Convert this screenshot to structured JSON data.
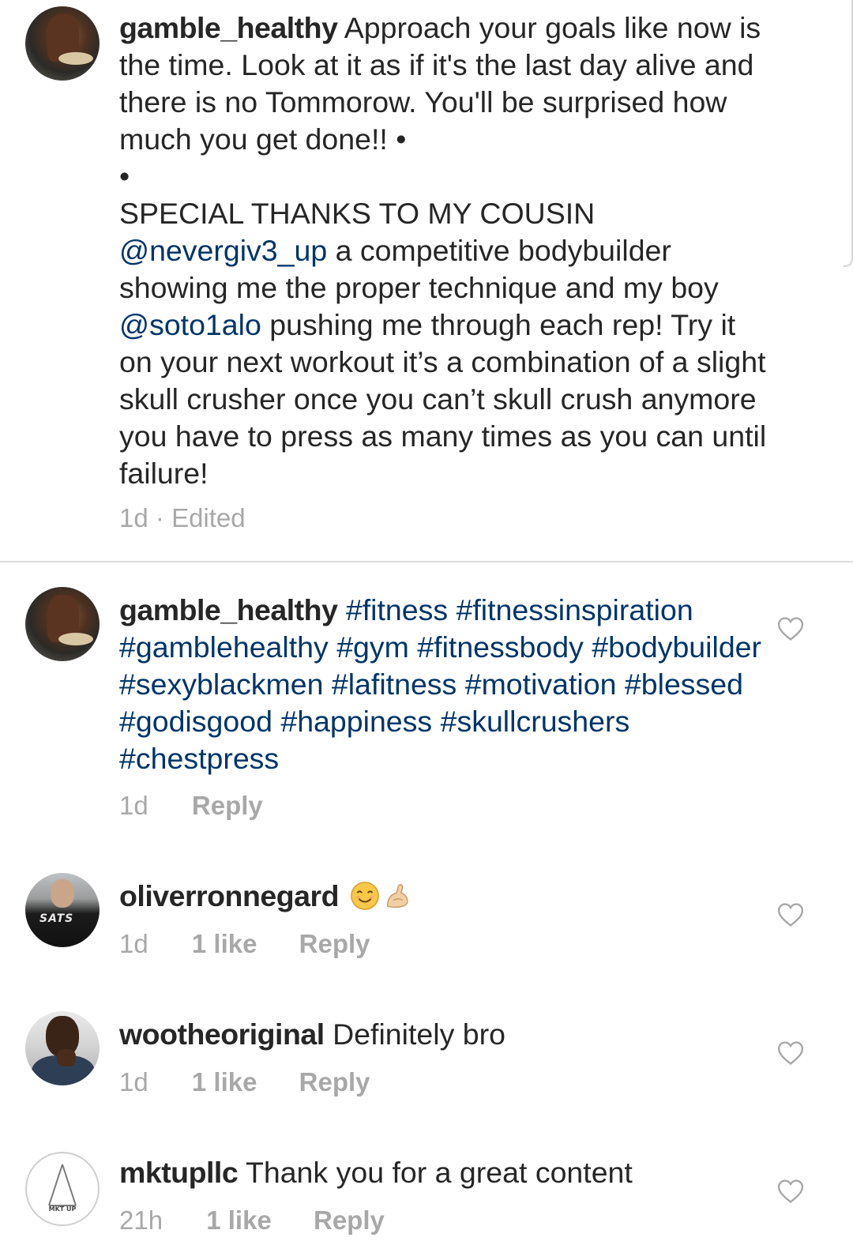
{
  "caption": {
    "username": "gamble_healthy",
    "text_line1": " Approach your goals like now is the time. Look at it as if it's the last day alive and there is no Tommorow. You'll be surprised how much you get done!! •",
    "bullet": "•",
    "special_thanks": "SPECIAL THANKS TO MY COUSIN",
    "mention1": "@nevergiv3_up",
    "text_after_mention1": " a competitive bodybuilder showing me the proper technique and my boy ",
    "mention2": "@soto1alo",
    "text_after_mention2": " pushing me through each rep! Try it on your next workout it’s a combination of a slight skull crusher once you can’t skull crush anymore you have to press as many times as you can until failure!",
    "time": "1d",
    "separator": "·",
    "edited": "Edited"
  },
  "comments": [
    {
      "username": "gamble_healthy",
      "hashtags": "#fitness #fitnessinspiration #gamblehealthy #gym #fitnessbody #bodybuilder #sexyblackmen #lafitness #motivation #blessed #godisgood #happiness #skullcrushers #chestpress",
      "time": "1d",
      "reply": "Reply"
    },
    {
      "username": "oliverronnegard",
      "emojis": [
        "smiling-face-emoji",
        "flexed-biceps-emoji"
      ],
      "time": "1d",
      "likes": "1 like",
      "reply": "Reply",
      "avatar_text": "SATS"
    },
    {
      "username": "wootheoriginal",
      "text": " Definitely bro",
      "time": "1d",
      "likes": "1 like",
      "reply": "Reply"
    },
    {
      "username": "mktupllc",
      "text": " Thank you for a great content",
      "time": "21h",
      "likes": "1 like",
      "reply": "Reply",
      "avatar_text": "MKT UP"
    }
  ],
  "colors": {
    "text": "#262626",
    "link": "#003569",
    "meta": "#a8a8a8",
    "divider": "#dbdbdb"
  },
  "icons": {
    "like": "heart-outline-icon"
  }
}
